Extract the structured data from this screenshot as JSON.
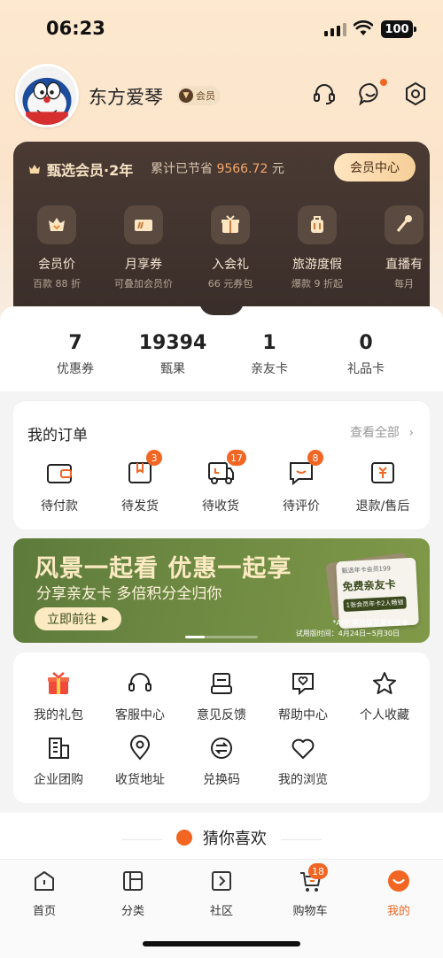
{
  "status_bar": {
    "time": "06:23",
    "battery": "100"
  },
  "profile": {
    "username": "东方爱琴",
    "member_tag": "会员"
  },
  "header_icons": [
    "headset-icon",
    "message-icon",
    "settings-icon"
  ],
  "member_card": {
    "title": "甄选会员·2年",
    "saved_label": "累计已节省",
    "saved_amount": "9566.72",
    "saved_unit": "元",
    "center_button": "会员中心",
    "perks": [
      {
        "label": "会员价",
        "sub": "百款 88 折",
        "icon": "heart-icon"
      },
      {
        "label": "月享券",
        "sub": "可叠加会员价",
        "icon": "coupon-icon"
      },
      {
        "label": "入会礼",
        "sub": "66 元券包",
        "icon": "gift-icon"
      },
      {
        "label": "旅游度假",
        "sub": "爆款 9 折起",
        "icon": "luggage-icon"
      },
      {
        "label": "直播有",
        "sub": "每月",
        "icon": "live-icon"
      }
    ]
  },
  "stats": [
    {
      "value": "7",
      "label": "优惠券"
    },
    {
      "value": "19394",
      "label": "甄果"
    },
    {
      "value": "1",
      "label": "亲友卡"
    },
    {
      "value": "0",
      "label": "礼品卡"
    }
  ],
  "orders": {
    "title": "我的订单",
    "view_all": "查看全部",
    "items": [
      {
        "label": "待付款",
        "badge": ""
      },
      {
        "label": "待发货",
        "badge": "3"
      },
      {
        "label": "待收货",
        "badge": "17"
      },
      {
        "label": "待评价",
        "badge": "8"
      },
      {
        "label": "退款/售后",
        "badge": ""
      }
    ]
  },
  "banner": {
    "headline": "风景一起看 优惠一起享",
    "subline": "分享亲友卡 多倍积分全归你",
    "button": "立即前往",
    "ticket_small": "甄选年卡会员199",
    "ticket_big": "免费亲友卡",
    "ticket_tag": "1张会员年卡2人畅锁",
    "note": "*APP 需升级至最新版本",
    "dates": "试用版时间：4月24日~5月30日"
  },
  "services": [
    {
      "label": "我的礼包"
    },
    {
      "label": "客服中心"
    },
    {
      "label": "意见反馈"
    },
    {
      "label": "帮助中心"
    },
    {
      "label": "个人收藏"
    },
    {
      "label": "企业团购"
    },
    {
      "label": "收货地址"
    },
    {
      "label": "兑换码"
    },
    {
      "label": "我的浏览"
    }
  ],
  "guess_title": "猜你喜欢",
  "tabbar": [
    {
      "label": "首页",
      "badge": ""
    },
    {
      "label": "分类",
      "badge": ""
    },
    {
      "label": "社区",
      "badge": ""
    },
    {
      "label": "购物车",
      "badge": "18"
    },
    {
      "label": "我的",
      "badge": ""
    }
  ],
  "colors": {
    "accent": "#f26522",
    "card_dark": "#3a2e2a",
    "gold": "#f6cf98",
    "banner_green": "#6e8a42"
  }
}
